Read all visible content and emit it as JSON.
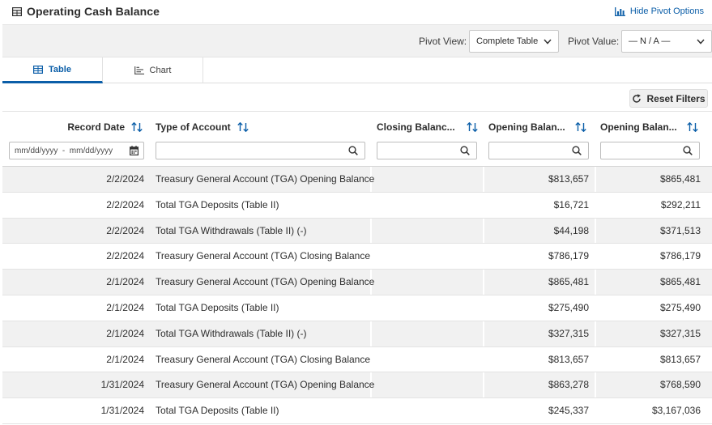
{
  "title": "Operating Cash Balance",
  "hide_pivot_label": "Hide Pivot Options",
  "pivot": {
    "view_label": "Pivot View:",
    "view_value": "Complete Table",
    "value_label": "Pivot Value:",
    "value_value": "— N / A —"
  },
  "tabs": [
    {
      "label": "Table",
      "active": true
    },
    {
      "label": "Chart",
      "active": false
    }
  ],
  "reset_filters_label": "Reset Filters",
  "columns": [
    {
      "label": "Record Date"
    },
    {
      "label": "Type of Account"
    },
    {
      "label": "Closing Balanc..."
    },
    {
      "label": "Opening Balan..."
    },
    {
      "label": "Opening Balan..."
    }
  ],
  "date_filter_placeholder": "mm/dd/yyyy  -  mm/dd/yyyy",
  "rows": [
    {
      "date": "2/2/2024",
      "type": "Treasury General Account (TGA) Opening Balance",
      "closing": "",
      "opening1": "$813,657",
      "opening2": "$865,481"
    },
    {
      "date": "2/2/2024",
      "type": "Total TGA Deposits (Table II)",
      "closing": "",
      "opening1": "$16,721",
      "opening2": "$292,211"
    },
    {
      "date": "2/2/2024",
      "type": "Total TGA Withdrawals (Table II) (-)",
      "closing": "",
      "opening1": "$44,198",
      "opening2": "$371,513"
    },
    {
      "date": "2/2/2024",
      "type": "Treasury General Account (TGA) Closing Balance",
      "closing": "",
      "opening1": "$786,179",
      "opening2": "$786,179"
    },
    {
      "date": "2/1/2024",
      "type": "Treasury General Account (TGA) Opening Balance",
      "closing": "",
      "opening1": "$865,481",
      "opening2": "$865,481"
    },
    {
      "date": "2/1/2024",
      "type": "Total TGA Deposits (Table II)",
      "closing": "",
      "opening1": "$275,490",
      "opening2": "$275,490"
    },
    {
      "date": "2/1/2024",
      "type": "Total TGA Withdrawals (Table II) (-)",
      "closing": "",
      "opening1": "$327,315",
      "opening2": "$327,315"
    },
    {
      "date": "2/1/2024",
      "type": "Treasury General Account (TGA) Closing Balance",
      "closing": "",
      "opening1": "$813,657",
      "opening2": "$813,657"
    },
    {
      "date": "1/31/2024",
      "type": "Treasury General Account (TGA) Opening Balance",
      "closing": "",
      "opening1": "$863,278",
      "opening2": "$768,590"
    },
    {
      "date": "1/31/2024",
      "type": "Total TGA Deposits (Table II)",
      "closing": "",
      "opening1": "$245,337",
      "opening2": "$3,167,036"
    }
  ]
}
